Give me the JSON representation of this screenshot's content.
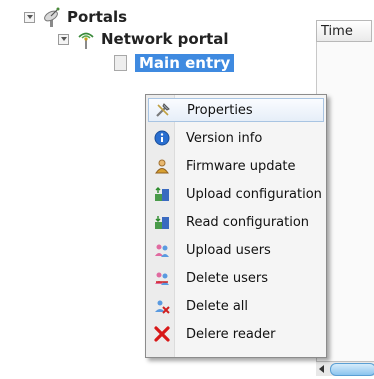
{
  "tree": {
    "root": {
      "label": "Portals",
      "icon": "satellite-icon"
    },
    "child": {
      "label": "Network portal",
      "icon": "antenna-icon"
    },
    "leaf": {
      "label": "Main entry",
      "icon": "document-icon"
    }
  },
  "grid": {
    "column_header": "Time"
  },
  "context_menu": {
    "items": [
      {
        "label": "Properties",
        "icon": "tools-icon"
      },
      {
        "label": "Version info",
        "icon": "info-icon"
      },
      {
        "label": "Firmware update",
        "icon": "user-update-icon"
      },
      {
        "label": "Upload configuration",
        "icon": "upload-config-icon"
      },
      {
        "label": "Read configuration",
        "icon": "read-config-icon"
      },
      {
        "label": "Upload users",
        "icon": "upload-users-icon"
      },
      {
        "label": "Delete users",
        "icon": "delete-users-icon"
      },
      {
        "label": "Delete all",
        "icon": "delete-all-icon"
      },
      {
        "label": "Delere reader",
        "icon": "red-x-icon"
      }
    ]
  },
  "colors": {
    "selection": "#3f8ae0",
    "menu_background": "#f5f5f5",
    "menu_hover": "#e6eef8"
  }
}
